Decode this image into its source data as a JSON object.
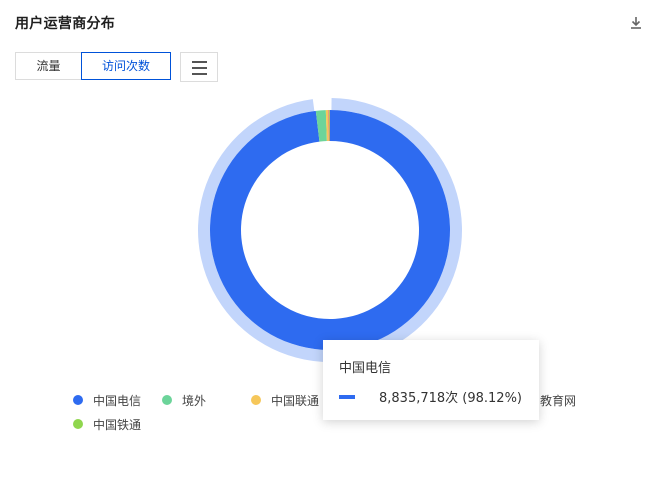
{
  "header": {
    "title": "用户运营商分布",
    "download_icon": "download-icon"
  },
  "tabs": [
    {
      "label": "流量",
      "active": false
    },
    {
      "label": "访问次数",
      "active": true
    }
  ],
  "menu_icon": "hamburger-menu-icon",
  "chart_data": {
    "type": "pie",
    "variant": "donut",
    "title": "用户运营商分布",
    "metric": "访问次数",
    "unit": "次",
    "categories": [
      "中国电信",
      "境外",
      "中国联通",
      "教育网",
      "中国铁通"
    ],
    "values": [
      8835718,
      120000,
      30000,
      12000,
      8000
    ],
    "percentages": [
      98.12,
      null,
      null,
      null,
      null
    ],
    "colors": [
      "#2e6bf0",
      "#6cd49a",
      "#f6c75a",
      "#e8747c",
      "#8fd64e"
    ],
    "highlighted": "中国电信",
    "legend_position": "bottom"
  },
  "tooltip": {
    "title": "中国电信",
    "value_text": "8,835,718次 (98.12%)",
    "swatch_color": "#2e6bf0"
  }
}
